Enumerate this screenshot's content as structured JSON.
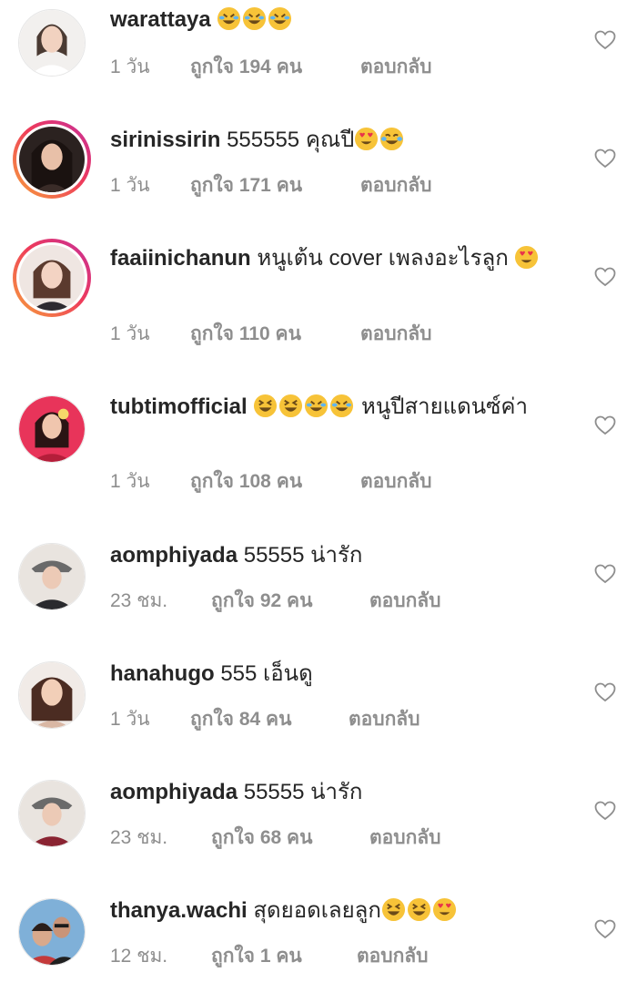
{
  "comments": [
    {
      "username": "warattaya",
      "text": "",
      "emojis": [
        "rofl",
        "rofl",
        "rofl"
      ],
      "time": "1 วัน",
      "likes": "ถูกใจ 194 คน",
      "reply": "ตอบกลับ"
    },
    {
      "username": "sirinissirin",
      "text": "555555 คุณปี",
      "emojis": [
        "heart-eyes",
        "joy"
      ],
      "time": "1 วัน",
      "likes": "ถูกใจ 171 คน",
      "reply": "ตอบกลับ"
    },
    {
      "username": "faaiinichanun",
      "text": "หนูเต้น cover เพลงอะไรลูก",
      "emojis": [
        "heart-eyes"
      ],
      "time": "1 วัน",
      "likes": "ถูกใจ 110 คน",
      "reply": "ตอบกลับ"
    },
    {
      "username": "tubtimofficial",
      "text_after": "หนูปีสายแดนซ์ค่า",
      "emojis": [
        "laughing",
        "laughing",
        "rofl",
        "rofl"
      ],
      "time": "1 วัน",
      "likes": "ถูกใจ 108 คน",
      "reply": "ตอบกลับ"
    },
    {
      "username": "aomphiyada",
      "text": "55555 น่ารัก",
      "emojis": [],
      "time": "23 ชม.",
      "likes": "ถูกใจ 92 คน",
      "reply": "ตอบกลับ"
    },
    {
      "username": "hanahugo",
      "text": "555 เอ็นดู",
      "emojis": [],
      "time": "1 วัน",
      "likes": "ถูกใจ 84 คน",
      "reply": "ตอบกลับ"
    },
    {
      "username": "aomphiyada",
      "text": "55555 น่ารัก",
      "emojis": [],
      "time": "23 ชม.",
      "likes": "ถูกใจ 68 คน",
      "reply": "ตอบกลับ"
    },
    {
      "username": "thanya.wachi",
      "text": "สุดยอดเลยลูก",
      "emojis": [
        "laughing",
        "laughing",
        "heart-eyes"
      ],
      "time": "12 ชม.",
      "likes": "ถูกใจ 1 คน",
      "reply": "ตอบกลับ"
    }
  ],
  "colors": {
    "text": "#262626",
    "meta": "#8e8e8e",
    "heart_outline": "#8e8e8e",
    "story_ring_start": "#f7a23b",
    "story_ring_end": "#c52f9b"
  }
}
